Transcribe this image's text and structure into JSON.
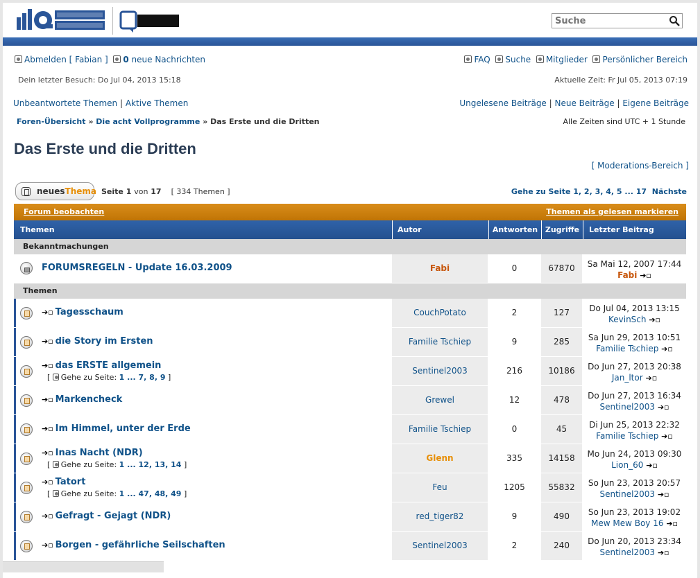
{
  "header": {
    "search_placeholder": "Suche"
  },
  "userbar": {
    "logout_label": "Abmelden [ Fabian ]",
    "messages_count": "0",
    "messages_label": " neue Nachrichten",
    "faq": "FAQ",
    "search": "Suche",
    "members": "Mitglieder",
    "ucp": "Persönlicher Bereich",
    "last_visit": "Dein letzter Besuch: Do Jul 04, 2013 15:18",
    "current_time": "Aktuelle Zeit: Fr Jul 05, 2013 07:19"
  },
  "quicklinks": {
    "unanswered": "Unbeantwortete Themen",
    "active": "Aktive Themen",
    "unread": "Ungelesene Beiträge",
    "new": "Neue Beiträge",
    "own": "Eigene Beiträge",
    "separator": "|"
  },
  "breadcrumb": {
    "index": "Foren-Übersicht",
    "forum": "Die acht Vollprogramme",
    "current": "Das Erste und die Dritten",
    "sep": "»",
    "timezone": "Alle Zeiten sind UTC + 1 Stunde"
  },
  "page": {
    "title": "Das Erste und die Dritten",
    "moderation": "[ Moderations-Bereich ]"
  },
  "new_topic": {
    "part1": "neues",
    "part2": "Thema"
  },
  "paging": {
    "page_prefix": "Seite",
    "page_current": "1",
    "page_of": "von",
    "page_total": "17",
    "topic_count": "[ 334 Themen ]",
    "goto_label": "Gehe zu Seite",
    "pages": "1, 2, 3, 4, 5 ... 17",
    "next": "Nächste"
  },
  "table": {
    "watch": "Forum beobachten",
    "mark_read": "Themen als gelesen markieren",
    "headers": [
      "Themen",
      "Autor",
      "Antworten",
      "Zugriffe",
      "Letzter Beitrag"
    ],
    "section_announcements": "Bekanntmachungen",
    "section_topics": "Themen",
    "announcement": {
      "title": "FORUMSREGELN - Update 16.03.2009",
      "author": "Fabi",
      "replies": "0",
      "views": "67870",
      "last_date": "Sa Mai 12, 2007 17:44",
      "last_author": "Fabi"
    },
    "goto_prefix": "[",
    "goto_text": "Gehe zu Seite:",
    "goto_suffix": "]",
    "topics": [
      {
        "title": "Tagesschaum",
        "author": "CouchPotato",
        "replies": "2",
        "views": "127",
        "last_date": "Do Jul 04, 2013 13:15",
        "last_author": "KevinSch",
        "pages": ""
      },
      {
        "title": "die Story im Ersten",
        "author": "Familie Tschiep",
        "replies": "9",
        "views": "285",
        "last_date": "Sa Jun 29, 2013 10:51",
        "last_author": "Familie Tschiep",
        "pages": ""
      },
      {
        "title": "das ERSTE allgemein",
        "author": "Sentinel2003",
        "replies": "216",
        "views": "10186",
        "last_date": "Do Jun 27, 2013 20:38",
        "last_author": "Jan_ltor",
        "pages": "1 ... 7, 8, 9"
      },
      {
        "title": "Markencheck",
        "author": "Grewel",
        "replies": "12",
        "views": "478",
        "last_date": "Do Jun 27, 2013 16:34",
        "last_author": "Sentinel2003",
        "pages": ""
      },
      {
        "title": "Im Himmel, unter der Erde",
        "author": "Familie Tschiep",
        "replies": "0",
        "views": "45",
        "last_date": "Di Jun 25, 2013 22:32",
        "last_author": "Familie Tschiep",
        "pages": ""
      },
      {
        "title": "Inas Nacht (NDR)",
        "author": "Glenn",
        "replies": "335",
        "views": "14158",
        "last_date": "Mo Jun 24, 2013 09:30",
        "last_author": "Lion_60",
        "pages": "1 ... 12, 13, 14"
      },
      {
        "title": "Tatort",
        "author": "Feu",
        "replies": "1205",
        "views": "55832",
        "last_date": "So Jun 23, 2013 20:57",
        "last_author": "Sentinel2003",
        "pages": "1 ... 47, 48, 49"
      },
      {
        "title": "Gefragt - Gejagt (NDR)",
        "author": "red_tiger82",
        "replies": "9",
        "views": "490",
        "last_date": "So Jun 23, 2013 19:02",
        "last_author": "Mew Mew Boy 16",
        "pages": ""
      },
      {
        "title": "Borgen - gefährliche Seilschaften",
        "author": "Sentinel2003",
        "replies": "2",
        "views": "240",
        "last_date": "Do Jun 20, 2013 23:34",
        "last_author": "Sentinel2003",
        "pages": ""
      }
    ]
  },
  "colors": {
    "link": "#105289",
    "header_blue": "#2f62a8",
    "orange_bar": "#d98d1a",
    "admin_name": "#c7560b"
  }
}
